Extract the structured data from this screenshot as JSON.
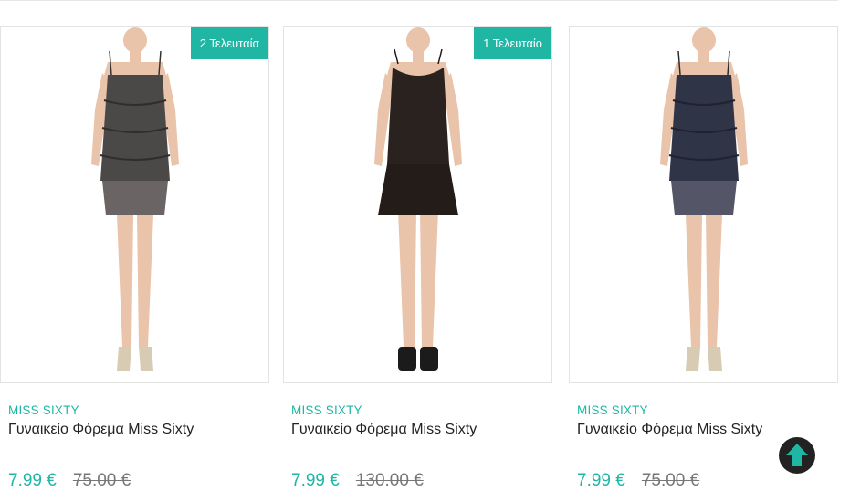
{
  "products": [
    {
      "badge": "1 Τελευταίο",
      "brand": "MISS SIXTY",
      "title": "Γυναικείο Φόρεμα Miss Sixty",
      "price": "7.99 €",
      "old_price": "130.00 €",
      "dress_colors": {
        "top": "#2a221e",
        "bottom": "#241c19"
      },
      "shoe_color": "#1b1b1b"
    },
    {
      "brand": "MISS SIXTY",
      "title": "Γυναικείο Φόρεμα Miss Sixty",
      "price": "7.99 €",
      "old_price": "75.00 €",
      "dress_colors": {
        "top": "#2f3547",
        "bottom": "#555568"
      },
      "shoe_color": "#d8cbb4"
    },
    {
      "badge": "2 Τελευταία",
      "brand": "MISS SIXTY",
      "title": "Γυναικείο Φόρεμα Miss Sixty",
      "price": "7.99 €",
      "old_price": "75.00 €",
      "dress_colors": {
        "top": "#4a4948",
        "bottom": "#6a6564"
      },
      "shoe_color": "#d8cbb4"
    }
  ],
  "scroll_top_icon": "arrow-up-icon",
  "colors": {
    "accent": "#1fb7a4",
    "text": "#222222",
    "muted": "#777777",
    "border": "#e3e3e3"
  }
}
